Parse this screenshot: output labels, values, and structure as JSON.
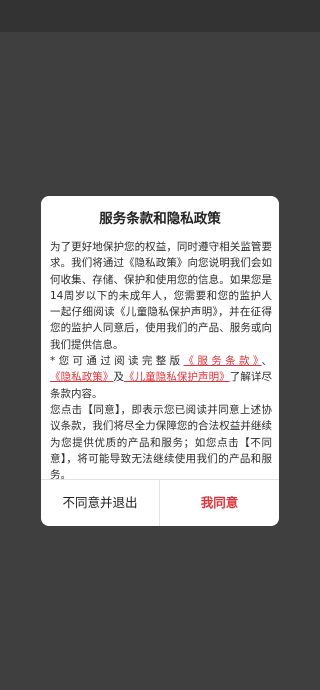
{
  "dialog": {
    "title": "服务条款和隐私政策",
    "para1": "为了更好地保护您的权益，同时遵守相关监管要求。我们将通过《隐私政策》向您说明我们会如何收集、存储、保护和使用您的信息。如果您是14周岁以下的未成年人，您需要和您的监护人一起仔细阅读《儿童隐私保护声明》，并在征得您的监护人同意后，使用我们的产品、服务或向我们提供信息。",
    "para2_prefix": "*您可通过阅读完整版",
    "link_terms": "《服务条款》",
    "sep1": "、",
    "link_privacy": "《隐私政策》",
    "sep2": "及",
    "link_children": "《儿童隐私保护声明》",
    "para2_suffix": "了解详尽条款内容。",
    "para3": "您点击【同意】，即表示您已阅读并同意上述协议条款，我们将尽全力保障您的合法权益并继续为您提供优质的产品和服务；如您点击【不同意】，将可能导致无法继续使用我们的产品和服务。",
    "disagree_label": "不同意并退出",
    "agree_label": "我同意"
  },
  "colors": {
    "overlay": "#3f3f3f",
    "accent": "#e2323a",
    "dialog_bg": "#ffffff"
  }
}
